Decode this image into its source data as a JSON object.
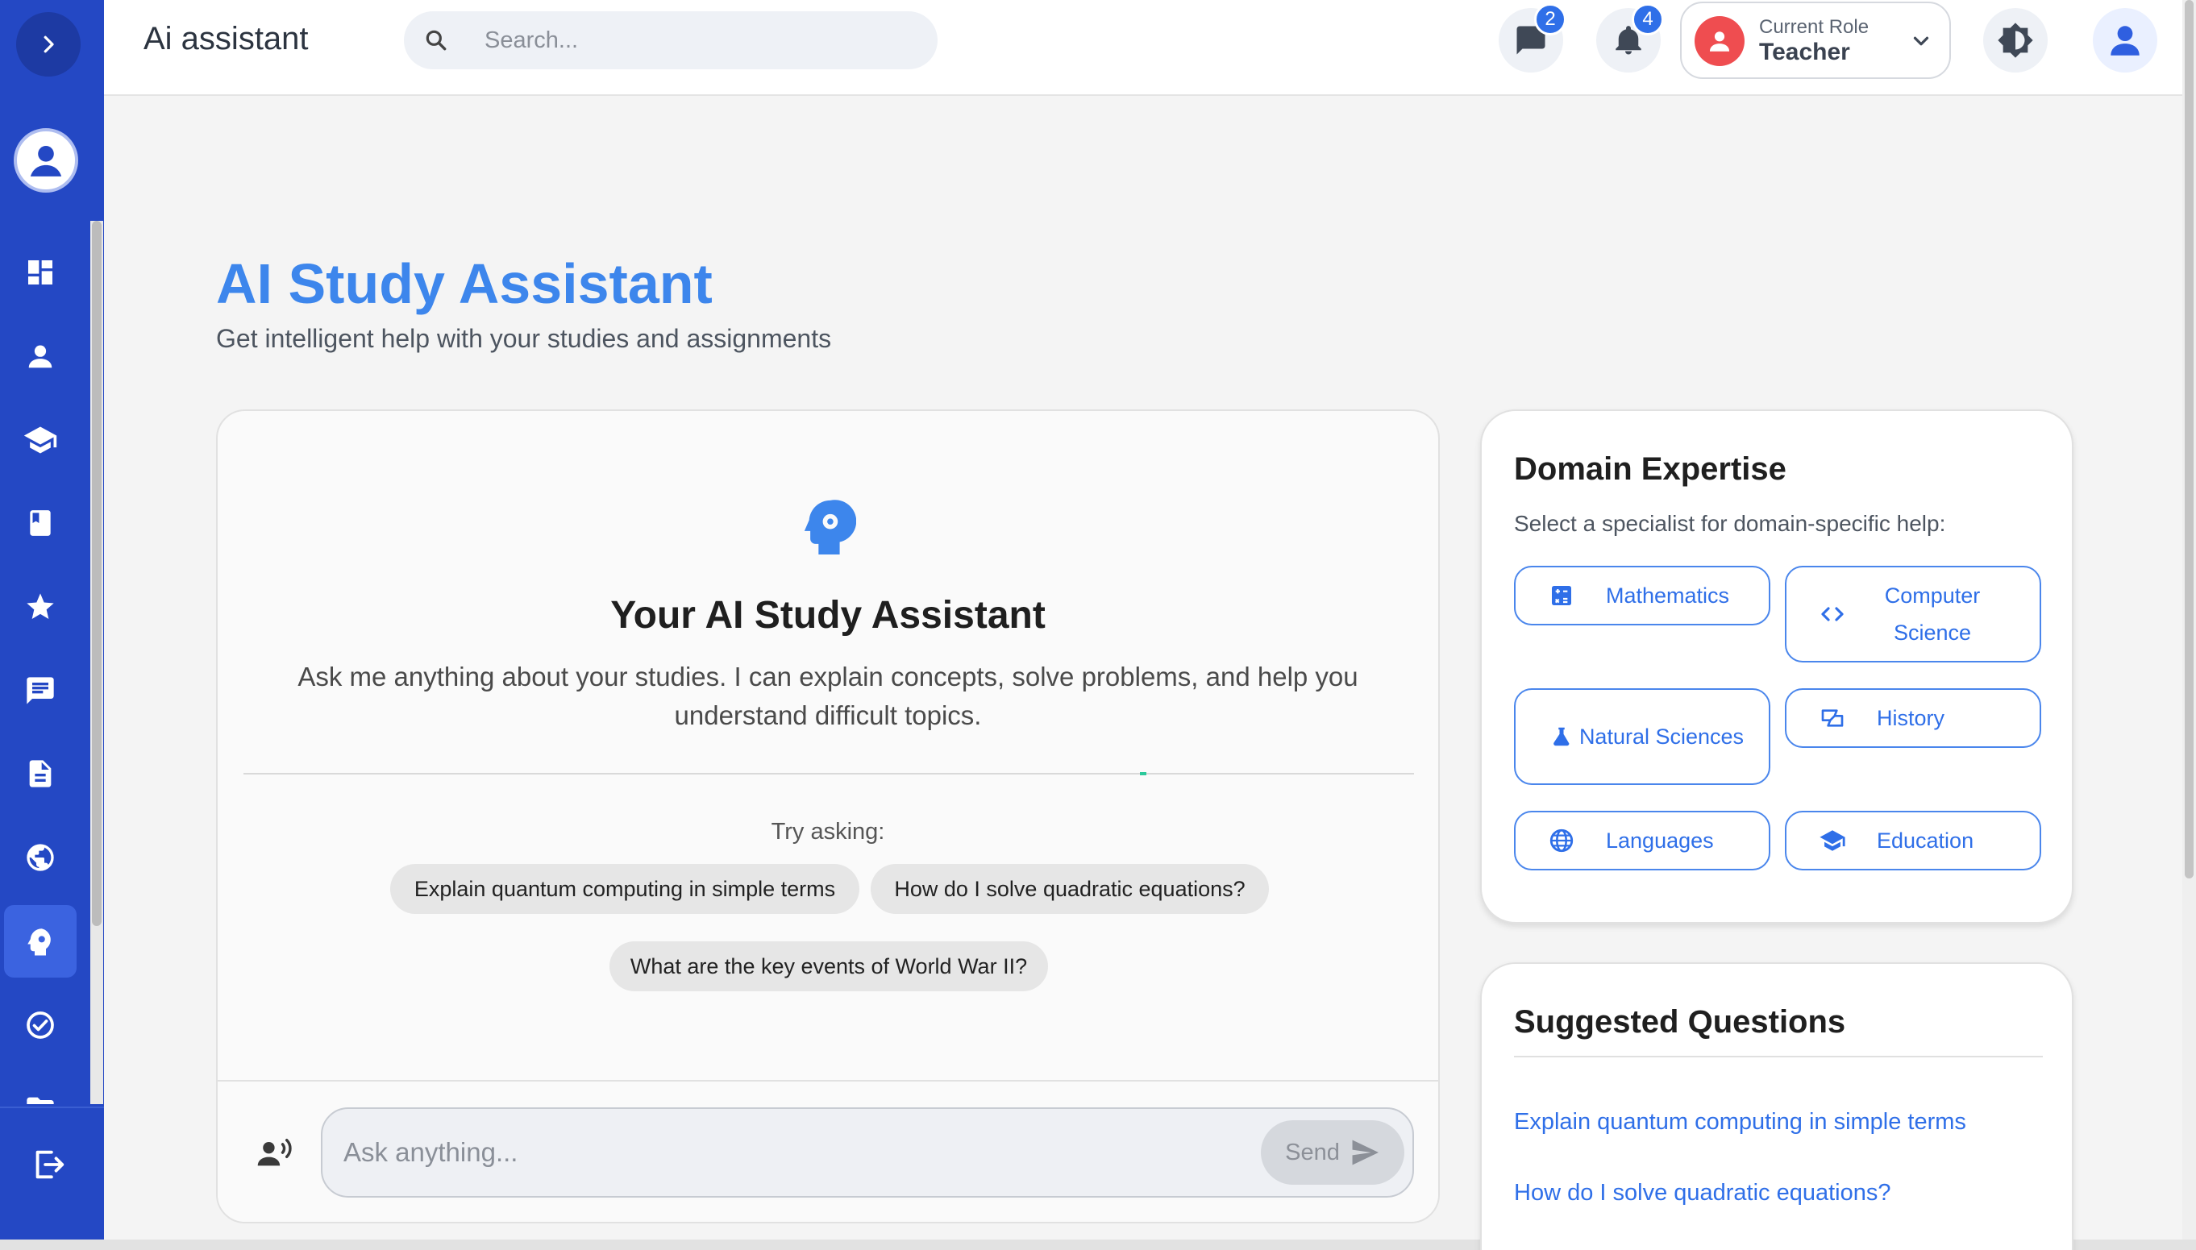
{
  "app": {
    "title": "Ai assistant"
  },
  "search": {
    "placeholder": "Search..."
  },
  "topbar": {
    "messages_badge": "2",
    "notifications_badge": "4",
    "role_label": "Current Role",
    "role_value": "Teacher"
  },
  "sidebar": {
    "items": [
      {
        "name": "dashboard",
        "icon": "dashboard-icon"
      },
      {
        "name": "profile",
        "icon": "person-icon"
      },
      {
        "name": "courses",
        "icon": "graduation-cap-icon"
      },
      {
        "name": "library",
        "icon": "book-icon"
      },
      {
        "name": "favorites",
        "icon": "star-icon"
      },
      {
        "name": "messages",
        "icon": "chat-icon"
      },
      {
        "name": "documents",
        "icon": "document-icon"
      },
      {
        "name": "global",
        "icon": "globe-icon"
      },
      {
        "name": "ai-assistant",
        "icon": "ai-head-icon",
        "active": true
      },
      {
        "name": "tasks",
        "icon": "check-circle-icon"
      },
      {
        "name": "folders",
        "icon": "folder-icon"
      }
    ]
  },
  "header": {
    "title": "AI Study Assistant",
    "subtitle": "Get intelligent help with your studies and assignments"
  },
  "chat": {
    "title": "Your AI Study Assistant",
    "description": "Ask me anything about your studies. I can explain concepts, solve problems, and help you understand difficult topics.",
    "try_label": "Try asking:",
    "suggestions": [
      "Explain quantum computing in simple terms",
      "How do I solve quadratic equations?",
      "What are the key events of World War II?"
    ],
    "input_placeholder": "Ask anything...",
    "send_label": "Send"
  },
  "domain": {
    "title": "Domain Expertise",
    "subtitle": "Select a specialist for domain-specific help:",
    "options": [
      {
        "label": "Mathematics",
        "icon": "calculator-icon"
      },
      {
        "label": "Computer Science",
        "icon": "code-icon"
      },
      {
        "label": "Natural Sciences",
        "icon": "flask-icon"
      },
      {
        "label": "History",
        "icon": "history-book-icon"
      },
      {
        "label": "Languages",
        "icon": "globe-icon"
      },
      {
        "label": "Education",
        "icon": "graduation-cap-icon"
      }
    ]
  },
  "suggested": {
    "title": "Suggested Questions",
    "items": [
      "Explain quantum computing in simple terms",
      "How do I solve quadratic equations?"
    ]
  },
  "colors": {
    "sidebar": "#2448c4",
    "accent": "#3d86ec",
    "link": "#2f6fe8",
    "role_avatar": "#ef4d50"
  }
}
